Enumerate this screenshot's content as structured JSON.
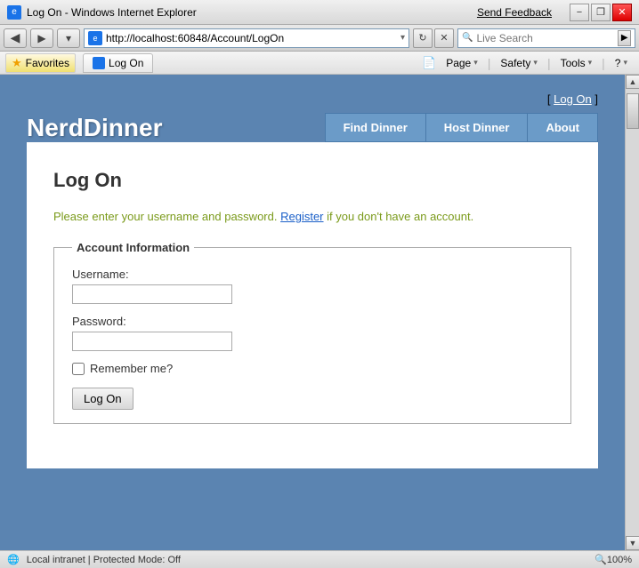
{
  "titlebar": {
    "icon": "e",
    "title": "Log On - Windows Internet Explorer",
    "send_feedback": "Send Feedback",
    "min": "−",
    "restore": "❐",
    "close": "✕"
  },
  "addressbar": {
    "url": "http://localhost:60848/Account/LogOn",
    "back": "◀",
    "forward": "▶",
    "dropdown": "▾",
    "refresh": "↻",
    "stop": "✕",
    "live_search_placeholder": "Live Search",
    "search_icon": "🔍"
  },
  "favoritesbar": {
    "favorites_label": "Favorites",
    "tab_label": "Log On",
    "page_label": "Page",
    "safety_label": "Safety",
    "tools_label": "Tools",
    "help_label": "?"
  },
  "app": {
    "title": "NerdDinner",
    "log_on_link_prefix": "[ ",
    "log_on_link_text": "Log On",
    "log_on_link_suffix": " ]",
    "nav": [
      {
        "id": "find-dinner",
        "label": "Find Dinner"
      },
      {
        "id": "host-dinner",
        "label": "Host Dinner"
      },
      {
        "id": "about",
        "label": "About"
      }
    ],
    "page_title": "Log On",
    "intro": "Please enter your username and password. ",
    "register_text": "Register",
    "intro_suffix": " if you don't have an account.",
    "fieldset_legend": "Account Information",
    "username_label": "Username:",
    "password_label": "Password:",
    "remember_label": "Remember me?",
    "submit_label": "Log On"
  },
  "statusbar": {
    "zone": "Local intranet | Protected Mode: Off",
    "zoom": "🔍100%"
  }
}
